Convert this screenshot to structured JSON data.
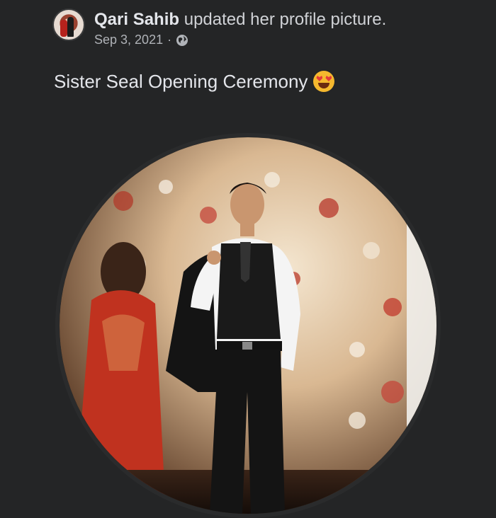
{
  "post": {
    "author": "Qari Sahib",
    "action": "updated her profile picture.",
    "date": "Sep 3, 2021",
    "separator": "·",
    "privacy_icon": "globe-icon",
    "caption": "Sister Seal Opening Ceremony",
    "caption_emoji": "smiling-face-with-heart-eyes-emoji"
  },
  "colors": {
    "background": "#242526",
    "text_primary": "#e4e6eb",
    "text_secondary": "#b0b3b8"
  }
}
